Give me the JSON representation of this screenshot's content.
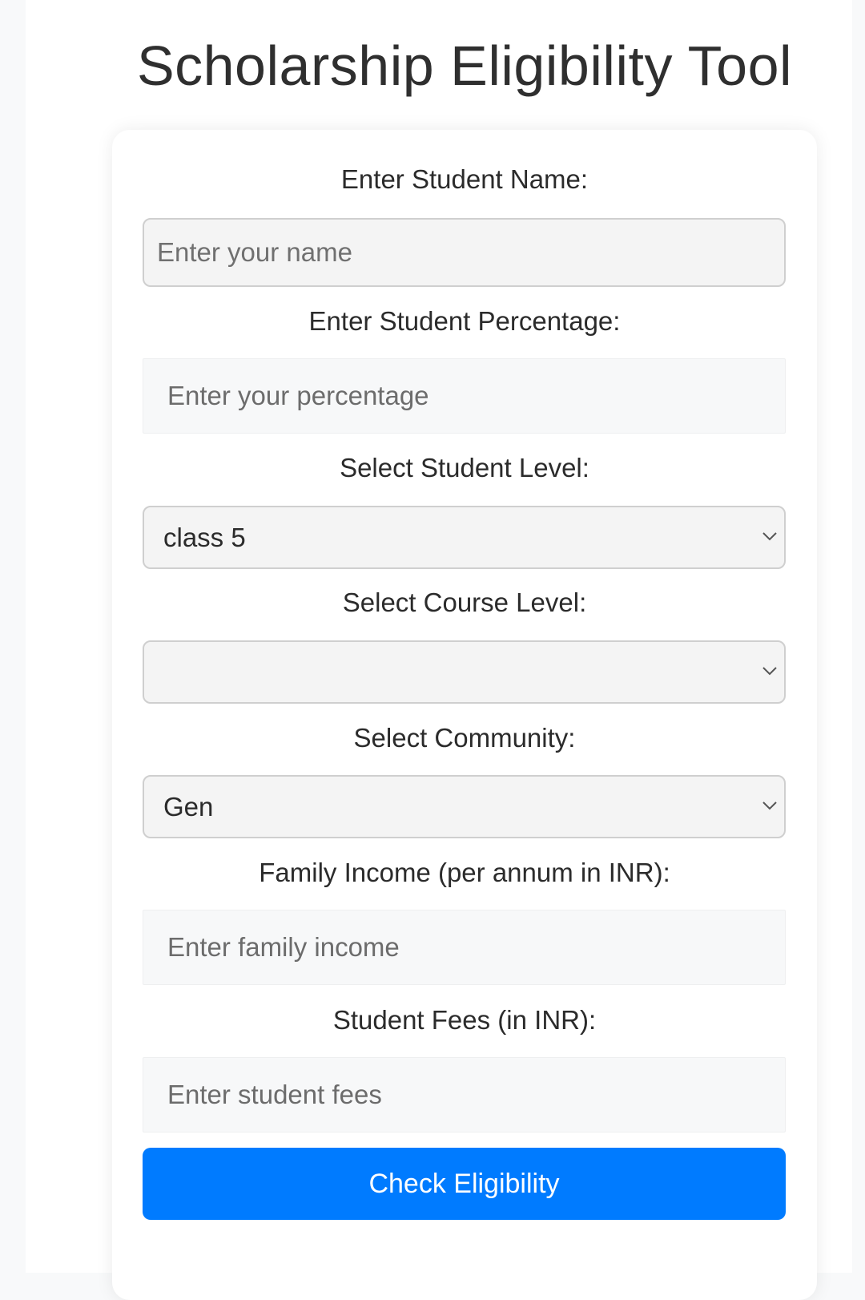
{
  "page": {
    "title": "Scholarship Eligibility Tool"
  },
  "form": {
    "student_name": {
      "label": "Enter Student Name:",
      "placeholder": "Enter your name",
      "value": ""
    },
    "student_percentage": {
      "label": "Enter Student Percentage:",
      "placeholder": "Enter your percentage",
      "value": ""
    },
    "student_level": {
      "label": "Select Student Level:",
      "selected": "class 5"
    },
    "course_level": {
      "label": "Select Course Level:",
      "selected": ""
    },
    "community": {
      "label": "Select Community:",
      "selected": "Gen"
    },
    "family_income": {
      "label": "Family Income (per annum in INR):",
      "placeholder": "Enter family income",
      "value": ""
    },
    "student_fees": {
      "label": "Student Fees (in INR):",
      "placeholder": "Enter student fees",
      "value": ""
    },
    "submit_label": "Check Eligibility"
  },
  "icons": {
    "select_chevron": "chevron-down-icon"
  },
  "colors": {
    "accent": "#007bff",
    "page_background": "#f8f9fa",
    "card_background": "#ffffff",
    "title_text": "#2f2f2f"
  }
}
